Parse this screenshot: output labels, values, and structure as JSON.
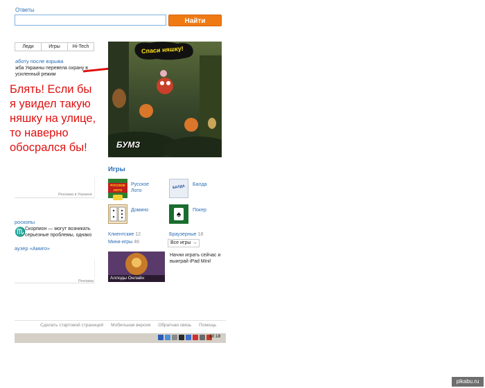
{
  "search": {
    "label": "Ответы",
    "value": "",
    "button": "Найти"
  },
  "tabs": [
    "Леди",
    "Игры",
    "Hi-Tech"
  ],
  "news": {
    "title": "аботу после взрыва",
    "text": "жба Украины перевела охрану в усиленный режим"
  },
  "annotation": "Блять! Если бы я увидел такую няшку на улице, то наверно обосрался бы!",
  "ads": {
    "label_1": "Реклама в Украине",
    "label_2": "Реклама"
  },
  "horoscope": {
    "title": "роскопы",
    "text": "Скорпион — могут возникать серьезные проблемы, однако"
  },
  "browser_link": "аузер «Амиго»",
  "banner": {
    "caption": "Спаси няшку!",
    "game_logo": "БУМЗ"
  },
  "games": {
    "title": "Игры",
    "items": [
      {
        "name": "Русское Лото",
        "thumb_label": "РУССКОЕ ЛОТО"
      },
      {
        "name": "Балда",
        "thumb_label": "БАЛДА"
      },
      {
        "name": "Домино",
        "thumb_label": ""
      },
      {
        "name": "Покер",
        "thumb_label": ""
      }
    ],
    "counts": [
      {
        "label": "Клиентские",
        "value": "12"
      },
      {
        "label": "Браузерные",
        "value": "18"
      },
      {
        "label": "Мини-игры",
        "value": "46"
      }
    ],
    "all_games": "Все игры →",
    "promo_img_label": "Аллоды Онлайн",
    "promo_text": "Начни играть сейчас и выиграй iPad Mini!"
  },
  "footer": {
    "links": [
      "Сделать стартовой страницей",
      "Мобильная версия",
      "Обратная связь",
      "Помощь"
    ]
  },
  "taskbar": {
    "clock": "10:18"
  },
  "watermark": "pikabu.ru"
}
